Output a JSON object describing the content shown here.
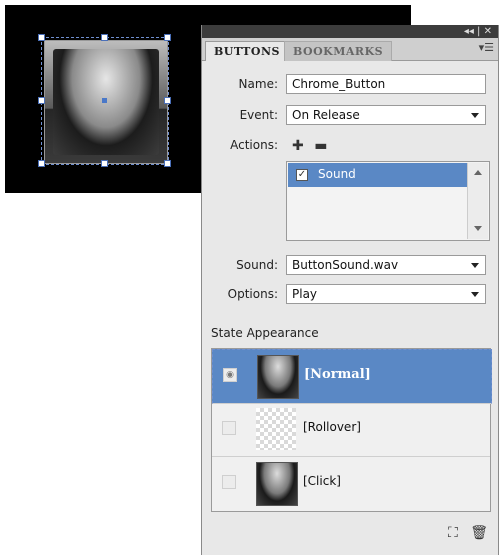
{
  "tabs": [
    {
      "label": "BUTTONS",
      "active": true
    },
    {
      "label": "BOOKMARKS",
      "active": false
    }
  ],
  "form": {
    "name_label": "Name:",
    "name_value": "Chrome_Button",
    "event_label": "Event:",
    "event_value": "On Release",
    "actions_label": "Actions:",
    "sound_label": "Sound:",
    "sound_value": "ButtonSound.wav",
    "options_label": "Options:",
    "options_value": "Play"
  },
  "actions_list": [
    {
      "label": "Sound",
      "checked": true
    }
  ],
  "state_appearance": {
    "title": "State Appearance",
    "states": [
      {
        "label": "[Normal]",
        "selected": true
      },
      {
        "label": "[Rollover]",
        "selected": false
      },
      {
        "label": "[Click]",
        "selected": false
      }
    ]
  },
  "icons": {
    "panel_collapse": "double-chevron-icon",
    "panel_menu": "panel-menu-icon",
    "add_action": "add-icon",
    "remove_action": "minus-icon",
    "convert_object": "convert-to-object-icon",
    "delete": "trash-icon"
  },
  "colors": {
    "selection": "#5a88c5",
    "canvas_bg": "#000000"
  }
}
